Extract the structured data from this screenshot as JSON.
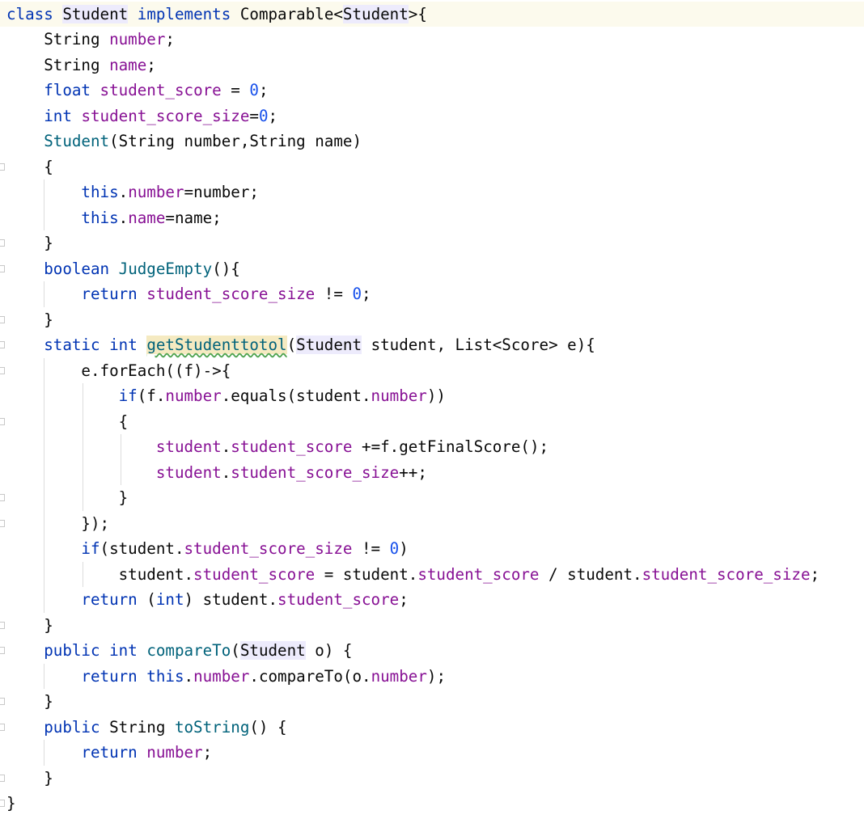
{
  "editor": {
    "lines": [
      [
        {
          "t": "class",
          "c": "kw"
        },
        {
          "t": " "
        },
        {
          "t": "Student",
          "c": "ref"
        },
        {
          "t": " "
        },
        {
          "t": "implements",
          "c": "kw"
        },
        {
          "t": " Comparable<"
        },
        {
          "t": "Student",
          "c": "ref"
        },
        {
          "t": ">{"
        }
      ],
      [
        {
          "t": "    String "
        },
        {
          "t": "number",
          "c": "fld"
        },
        {
          "t": ";"
        }
      ],
      [
        {
          "t": "    String "
        },
        {
          "t": "name",
          "c": "fld"
        },
        {
          "t": ";"
        }
      ],
      [
        {
          "t": "    "
        },
        {
          "t": "float",
          "c": "kw"
        },
        {
          "t": " "
        },
        {
          "t": "student_score",
          "c": "fld"
        },
        {
          "t": " = "
        },
        {
          "t": "0",
          "c": "num"
        },
        {
          "t": ";"
        }
      ],
      [
        {
          "t": "    "
        },
        {
          "t": "int",
          "c": "kw"
        },
        {
          "t": " "
        },
        {
          "t": "student_score_size",
          "c": "fld"
        },
        {
          "t": "="
        },
        {
          "t": "0",
          "c": "num"
        },
        {
          "t": ";"
        }
      ],
      [
        {
          "t": "    "
        },
        {
          "t": "Student",
          "c": "fn"
        },
        {
          "t": "(String number,String name)"
        }
      ],
      [
        {
          "t": "    {"
        }
      ],
      [
        {
          "t": "        "
        },
        {
          "t": "this",
          "c": "kw"
        },
        {
          "t": "."
        },
        {
          "t": "number",
          "c": "fld"
        },
        {
          "t": "=number;"
        }
      ],
      [
        {
          "t": "        "
        },
        {
          "t": "this",
          "c": "kw"
        },
        {
          "t": "."
        },
        {
          "t": "name",
          "c": "fld"
        },
        {
          "t": "=name;"
        }
      ],
      [
        {
          "t": "    }"
        }
      ],
      [
        {
          "t": "    "
        },
        {
          "t": "boolean",
          "c": "kw"
        },
        {
          "t": " "
        },
        {
          "t": "JudgeEmpty",
          "c": "fn"
        },
        {
          "t": "(){"
        }
      ],
      [
        {
          "t": "        "
        },
        {
          "t": "return",
          "c": "kw"
        },
        {
          "t": " "
        },
        {
          "t": "student_score_size",
          "c": "fld"
        },
        {
          "t": " != "
        },
        {
          "t": "0",
          "c": "num"
        },
        {
          "t": ";"
        }
      ],
      [
        {
          "t": "    }"
        }
      ],
      [
        {
          "t": "    "
        },
        {
          "t": "static",
          "c": "kw"
        },
        {
          "t": " "
        },
        {
          "t": "int",
          "c": "kw"
        },
        {
          "t": " "
        },
        {
          "t": "getStudenttotol",
          "c": "fn warn"
        },
        {
          "t": "("
        },
        {
          "t": "Student",
          "c": "ref"
        },
        {
          "t": " student, List<Score> e){"
        }
      ],
      [
        {
          "t": "        e.forEach((f)->{"
        }
      ],
      [
        {
          "t": "            "
        },
        {
          "t": "if",
          "c": "kw"
        },
        {
          "t": "(f."
        },
        {
          "t": "number",
          "c": "fld"
        },
        {
          "t": ".equals(student."
        },
        {
          "t": "number",
          "c": "fld"
        },
        {
          "t": "))"
        }
      ],
      [
        {
          "t": "            {"
        }
      ],
      [
        {
          "t": "                "
        },
        {
          "t": "student",
          "c": "fld"
        },
        {
          "t": "."
        },
        {
          "t": "student_score",
          "c": "fld"
        },
        {
          "t": " +=f.getFinalScore();"
        }
      ],
      [
        {
          "t": "                "
        },
        {
          "t": "student",
          "c": "fld"
        },
        {
          "t": "."
        },
        {
          "t": "student_score_size",
          "c": "fld"
        },
        {
          "t": "++;"
        }
      ],
      [
        {
          "t": "            }"
        }
      ],
      [
        {
          "t": "        });"
        }
      ],
      [
        {
          "t": "        "
        },
        {
          "t": "if",
          "c": "kw"
        },
        {
          "t": "(student."
        },
        {
          "t": "student_score_size",
          "c": "fld"
        },
        {
          "t": " != "
        },
        {
          "t": "0",
          "c": "num"
        },
        {
          "t": ")"
        }
      ],
      [
        {
          "t": "            student."
        },
        {
          "t": "student_score",
          "c": "fld"
        },
        {
          "t": " = student."
        },
        {
          "t": "student_score",
          "c": "fld"
        },
        {
          "t": " / student."
        },
        {
          "t": "student_score_size",
          "c": "fld"
        },
        {
          "t": ";"
        }
      ],
      [
        {
          "t": "        "
        },
        {
          "t": "return",
          "c": "kw"
        },
        {
          "t": " ("
        },
        {
          "t": "int",
          "c": "kw"
        },
        {
          "t": ") student."
        },
        {
          "t": "student_score",
          "c": "fld"
        },
        {
          "t": ";"
        }
      ],
      [
        {
          "t": "    }"
        }
      ],
      [
        {
          "t": "    "
        },
        {
          "t": "public",
          "c": "kw"
        },
        {
          "t": " "
        },
        {
          "t": "int",
          "c": "kw"
        },
        {
          "t": " "
        },
        {
          "t": "compareTo",
          "c": "fn"
        },
        {
          "t": "("
        },
        {
          "t": "Student",
          "c": "ref"
        },
        {
          "t": " o) {"
        }
      ],
      [
        {
          "t": "        "
        },
        {
          "t": "return",
          "c": "kw"
        },
        {
          "t": " "
        },
        {
          "t": "this",
          "c": "kw"
        },
        {
          "t": "."
        },
        {
          "t": "number",
          "c": "fld"
        },
        {
          "t": ".compareTo(o."
        },
        {
          "t": "number",
          "c": "fld"
        },
        {
          "t": ");"
        }
      ],
      [
        {
          "t": "    }"
        }
      ],
      [
        {
          "t": "    "
        },
        {
          "t": "public",
          "c": "kw"
        },
        {
          "t": " String "
        },
        {
          "t": "toString",
          "c": "fn"
        },
        {
          "t": "() {"
        }
      ],
      [
        {
          "t": "        "
        },
        {
          "t": "return",
          "c": "kw"
        },
        {
          "t": " "
        },
        {
          "t": "number",
          "c": "fld"
        },
        {
          "t": ";"
        }
      ],
      [
        {
          "t": "    }"
        }
      ],
      [
        {
          "t": "}"
        }
      ]
    ],
    "colors": {
      "keyword": "#0033b3",
      "field": "#871094",
      "number": "#1750eb",
      "method": "#00627a",
      "text": "#080808",
      "current_line_bg": "#fcfaed",
      "reference_highlight_bg": "#edebfc",
      "warning_bg": "#f5eac1"
    }
  }
}
